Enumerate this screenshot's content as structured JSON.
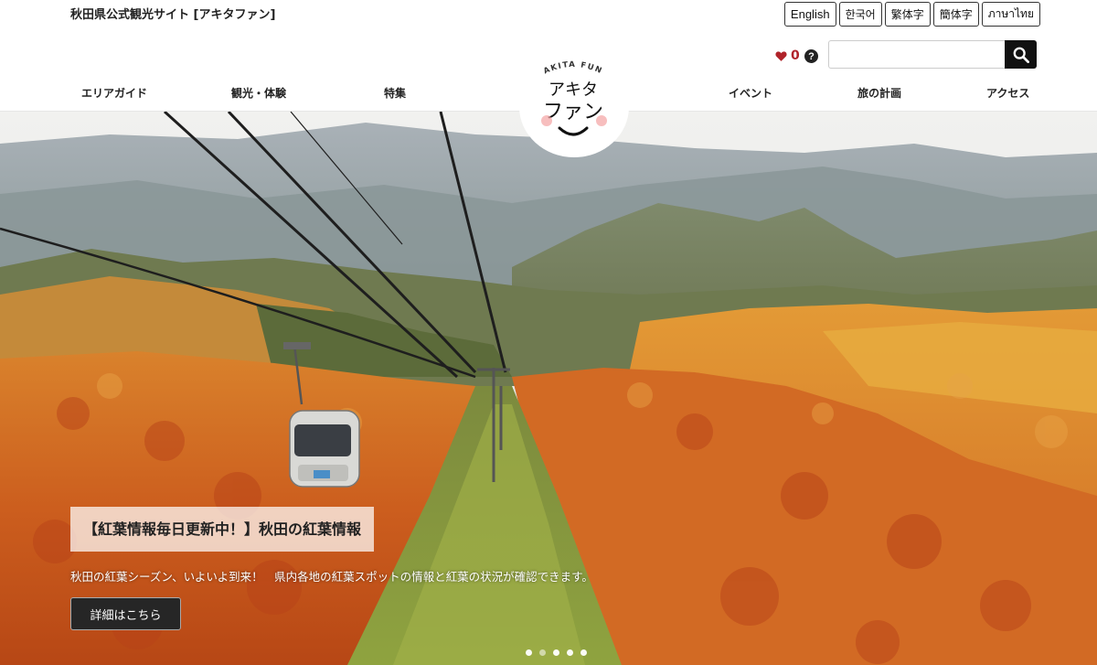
{
  "site": {
    "title": "秋田県公式観光サイト [アキタファン]"
  },
  "languages": [
    "English",
    "한국어",
    "繁体字",
    "簡体字",
    "ภาษาไทย"
  ],
  "favorites": {
    "count": "0"
  },
  "search": {
    "placeholder": ""
  },
  "nav": {
    "left": [
      "エリアガイド",
      "観光・体験",
      "特集"
    ],
    "right": [
      "イベント",
      "旅の計画",
      "アクセス"
    ]
  },
  "logo": {
    "arc_text": "AKITA FUN",
    "line1": "アキタ",
    "line2": "ファン"
  },
  "hero": {
    "caption": "【紅葉情報毎日更新中！】秋田の紅葉情報",
    "text": "秋田の紅葉シーズン、いよいよ到来！　県内各地の紅葉スポットの情報と紅葉の状況が確認できます。",
    "button": "詳細はこちら",
    "slide_count": 5,
    "active_slide": 1
  },
  "colors": {
    "accent_red": "#b0232a",
    "dark": "#111111"
  },
  "icons": [
    "heart-icon",
    "help-icon",
    "search-icon"
  ]
}
